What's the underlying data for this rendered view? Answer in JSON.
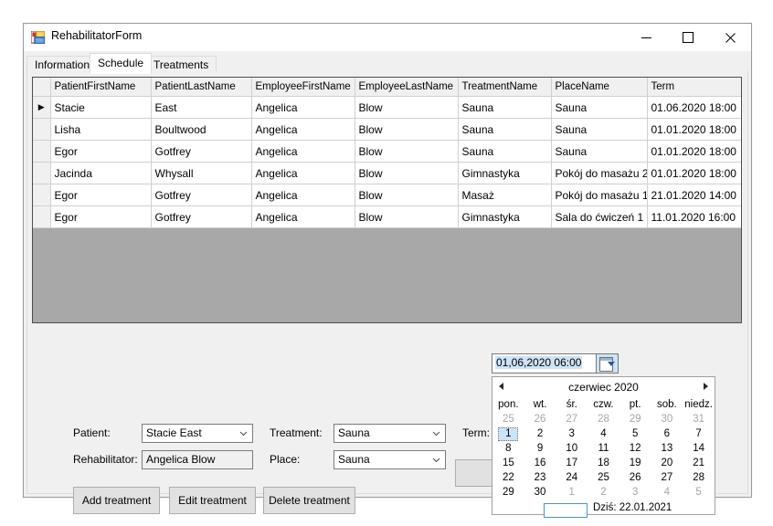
{
  "window": {
    "title": "RehabilitatorForm",
    "minimize_label": "–",
    "maximize_label": "□",
    "close_label": "✕"
  },
  "tabs": [
    {
      "label": "Informations",
      "active": false
    },
    {
      "label": "Schedule",
      "active": true
    },
    {
      "label": "Treatments",
      "active": false
    }
  ],
  "grid": {
    "columns": [
      "PatientFirstName",
      "PatientLastName",
      "EmployeeFirstName",
      "EmployeeLastName",
      "TreatmentName",
      "PlaceName",
      "Term"
    ],
    "rows": [
      {
        "selected_row": true,
        "selected_cell": 1,
        "cells": [
          "Stacie",
          "East",
          "Angelica",
          "Blow",
          "Sauna",
          "Sauna",
          "01.06.2020 18:00"
        ]
      },
      {
        "selected_row": false,
        "selected_cell": -1,
        "cells": [
          "Lisha",
          "Boultwood",
          "Angelica",
          "Blow",
          "Sauna",
          "Sauna",
          "01.01.2020 18:00"
        ]
      },
      {
        "selected_row": false,
        "selected_cell": -1,
        "cells": [
          "Egor",
          "Gotfrey",
          "Angelica",
          "Blow",
          "Sauna",
          "Sauna",
          "01.01.2020 18:00"
        ]
      },
      {
        "selected_row": false,
        "selected_cell": -1,
        "cells": [
          "Jacinda",
          "Whysall",
          "Angelica",
          "Blow",
          "Gimnastyka",
          "Pokój do masażu 2",
          "01.01.2020 18:00"
        ]
      },
      {
        "selected_row": false,
        "selected_cell": -1,
        "cells": [
          "Egor",
          "Gotfrey",
          "Angelica",
          "Blow",
          "Masaż",
          "Pokój do masażu 1",
          "21.01.2020 14:00"
        ]
      },
      {
        "selected_row": false,
        "selected_cell": -1,
        "cells": [
          "Egor",
          "Gotfrey",
          "Angelica",
          "Blow",
          "Gimnastyka",
          "Sala do ćwiczeń 1",
          "11.01.2020 16:00"
        ]
      }
    ],
    "row_marker": "▶",
    "selection_color": "#0078d7"
  },
  "form": {
    "patient_label": "Patient:",
    "patient_value": "Stacie East",
    "rehabilitator_label": "Rehabilitator:",
    "rehabilitator_value": "Angelica Blow",
    "treatment_label": "Treatment:",
    "treatment_value": "Sauna",
    "place_label": "Place:",
    "place_value": "Sauna",
    "term_label": "Term:",
    "term_value": "01,06,2020 06:00"
  },
  "buttons": {
    "add": "Add treatment",
    "edit": "Edit treatment",
    "delete": "Delete treatment"
  },
  "calendar": {
    "month_title": "czerwiec 2020",
    "prev_label": "◀",
    "next_label": "▶",
    "weekdays": [
      "pon.",
      "wt.",
      "śr.",
      "czw.",
      "pt.",
      "sob.",
      "niedz."
    ],
    "weeks": [
      [
        {
          "d": "25",
          "dim": true
        },
        {
          "d": "26",
          "dim": true
        },
        {
          "d": "27",
          "dim": true
        },
        {
          "d": "28",
          "dim": true
        },
        {
          "d": "29",
          "dim": true
        },
        {
          "d": "30",
          "dim": true
        },
        {
          "d": "31",
          "dim": true
        }
      ],
      [
        {
          "d": "1",
          "dim": false,
          "today": true
        },
        {
          "d": "2",
          "dim": false
        },
        {
          "d": "3",
          "dim": false
        },
        {
          "d": "4",
          "dim": false
        },
        {
          "d": "5",
          "dim": false
        },
        {
          "d": "6",
          "dim": false
        },
        {
          "d": "7",
          "dim": false
        }
      ],
      [
        {
          "d": "8",
          "dim": false
        },
        {
          "d": "9",
          "dim": false
        },
        {
          "d": "10",
          "dim": false
        },
        {
          "d": "11",
          "dim": false
        },
        {
          "d": "12",
          "dim": false
        },
        {
          "d": "13",
          "dim": false
        },
        {
          "d": "14",
          "dim": false
        }
      ],
      [
        {
          "d": "15",
          "dim": false
        },
        {
          "d": "16",
          "dim": false
        },
        {
          "d": "17",
          "dim": false
        },
        {
          "d": "18",
          "dim": false
        },
        {
          "d": "19",
          "dim": false
        },
        {
          "d": "20",
          "dim": false
        },
        {
          "d": "21",
          "dim": false
        }
      ],
      [
        {
          "d": "22",
          "dim": false
        },
        {
          "d": "23",
          "dim": false
        },
        {
          "d": "24",
          "dim": false
        },
        {
          "d": "25",
          "dim": false
        },
        {
          "d": "26",
          "dim": false
        },
        {
          "d": "27",
          "dim": false
        },
        {
          "d": "28",
          "dim": false
        }
      ],
      [
        {
          "d": "29",
          "dim": false
        },
        {
          "d": "30",
          "dim": false
        },
        {
          "d": "1",
          "dim": true
        },
        {
          "d": "2",
          "dim": true
        },
        {
          "d": "3",
          "dim": true
        },
        {
          "d": "4",
          "dim": true
        },
        {
          "d": "5",
          "dim": true
        }
      ]
    ],
    "today_text": "Dziś: 22.01.2021"
  }
}
